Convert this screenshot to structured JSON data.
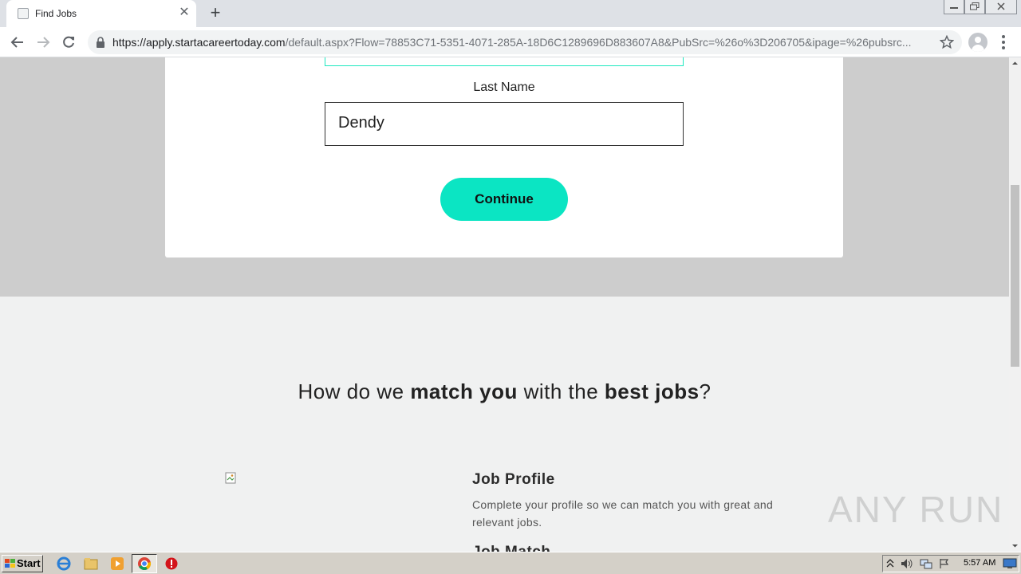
{
  "browser": {
    "tab_title": "Find Jobs",
    "url_host": "https://apply.startacareertoday.com",
    "url_path": "/default.aspx?Flow=78853C71-5351-4071-285A-18D6C1289696D883607A8&PubSrc=%26o%3D206705&ipage=%26pubsrc..."
  },
  "form": {
    "last_name_label": "Last Name",
    "last_name_value": "Dendy",
    "continue_label": "Continue"
  },
  "section": {
    "heading_part1": "How do we ",
    "heading_bold1": "match you",
    "heading_part2": " with the ",
    "heading_bold2": "best jobs",
    "heading_part3": "?",
    "feature1_title": "Job Profile",
    "feature1_desc": "Complete your profile so we can match you with great and relevant jobs.",
    "feature2_title": "Job Match"
  },
  "watermark": "ANY RUN",
  "taskbar": {
    "start_label": "Start",
    "clock": "5:57 AM"
  },
  "colors": {
    "accent": "#0be5c3",
    "gray_band": "#cdcdcd",
    "lower_bg": "#f0f1f1"
  }
}
